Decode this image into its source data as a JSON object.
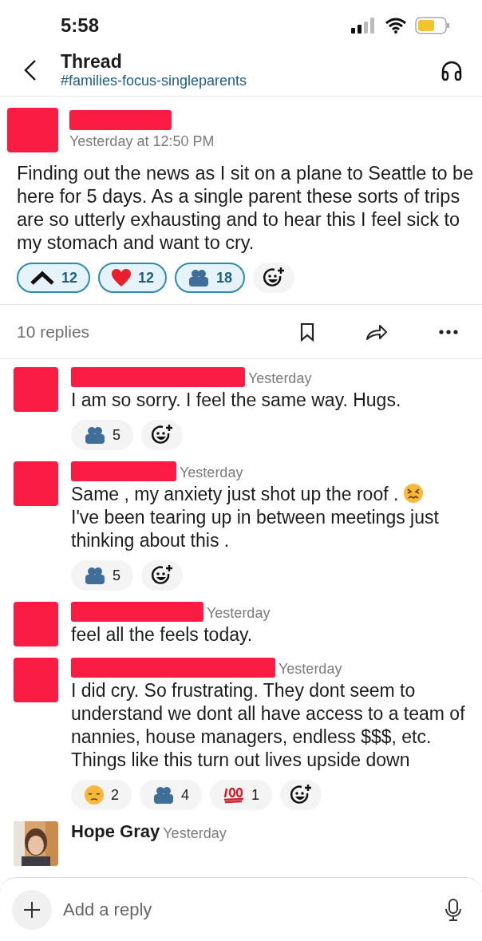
{
  "status_bar": {
    "time": "5:58"
  },
  "header": {
    "title": "Thread",
    "channel": "#families-focus-singleparents"
  },
  "post": {
    "timestamp": "Yesterday at 12:50 PM",
    "body": "Finding out the news as I sit on a plane to Seattle to be here for 5 days. As a single parent these sorts of trips are so utterly exhausting and to hear this I feel sick to my stomach and want to cry.",
    "reactions": [
      {
        "kind": "upvote",
        "count": "12",
        "selected": true
      },
      {
        "kind": "heart",
        "count": "12",
        "selected": true
      },
      {
        "kind": "people",
        "count": "18",
        "selected": true
      }
    ]
  },
  "replies_bar": {
    "label": "10 replies"
  },
  "replies": [
    {
      "timestamp": "Yesterday",
      "body": [
        {
          "text": "I am so sorry. I feel the same way. Hugs."
        }
      ],
      "reactions": [
        {
          "kind": "people",
          "count": "5",
          "selected": false
        }
      ]
    },
    {
      "timestamp": "Yesterday",
      "body": [
        {
          "text": "Same , my anxiety just shot up the roof ."
        },
        {
          "kind": "persevere-emoji"
        },
        {
          "text": "I've been tearing up in between meetings just thinking about this ."
        }
      ],
      "reactions": [
        {
          "kind": "people",
          "count": "5",
          "selected": false
        }
      ]
    },
    {
      "timestamp": "Yesterday",
      "body": [
        {
          "text": "feel all the feels today."
        }
      ]
    },
    {
      "timestamp": "Yesterday",
      "body": [
        {
          "text": "I did cry. So frustrating. They dont seem to understand we dont all have access to a team of nannies, house managers, endless $$$, etc. Things like this turn out lives upside down"
        }
      ],
      "reactions": [
        {
          "kind": "sad",
          "count": "2",
          "selected": false
        },
        {
          "kind": "people",
          "count": "4",
          "selected": false
        },
        {
          "kind": "hundred",
          "count": "1",
          "selected": false
        }
      ]
    },
    {
      "name": "Hope Gray",
      "timestamp": "Yesterday"
    }
  ],
  "composer": {
    "placeholder": "Add a reply"
  }
}
